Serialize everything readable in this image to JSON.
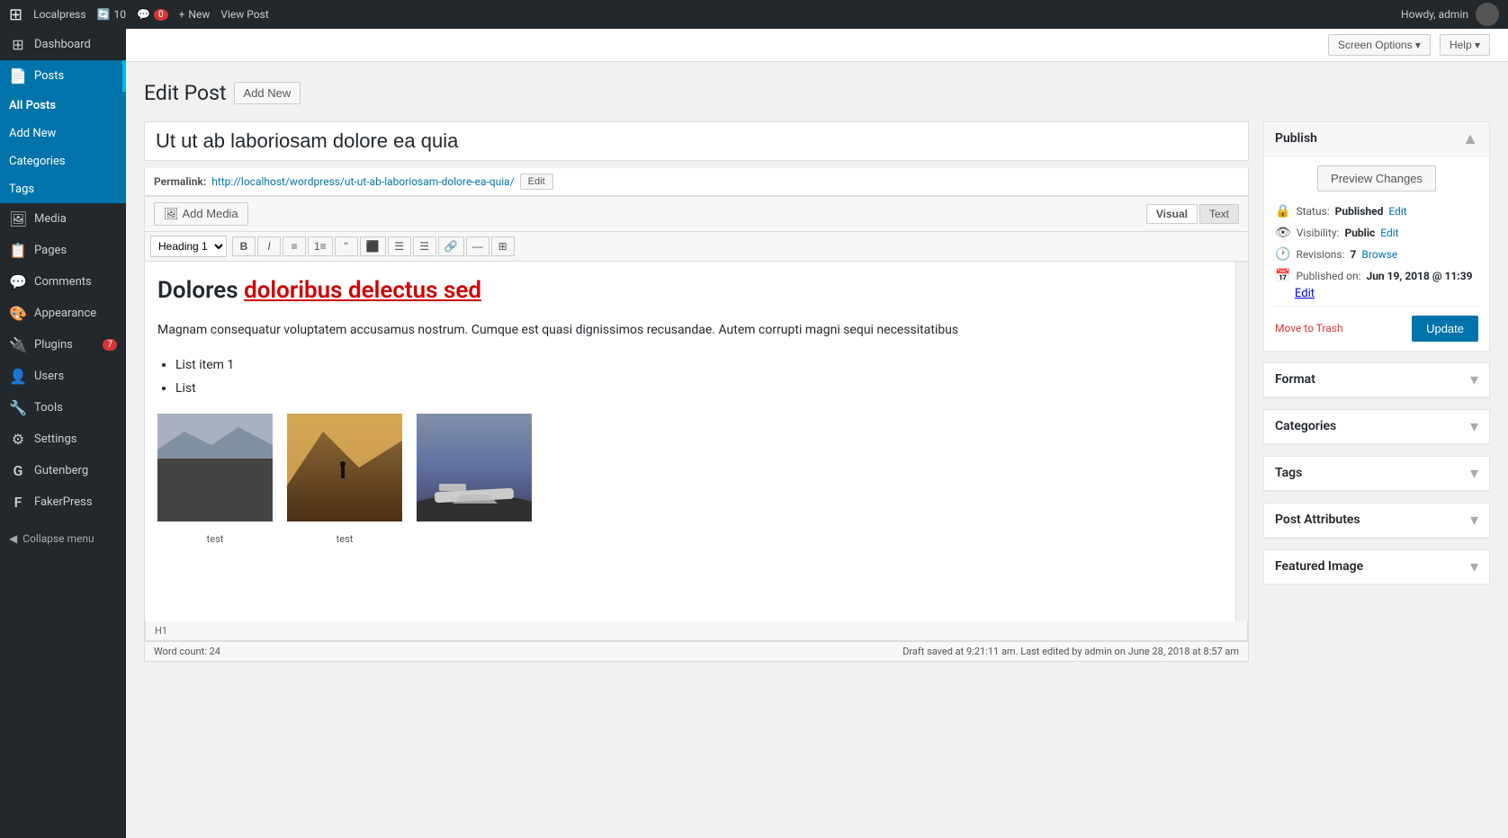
{
  "adminbar": {
    "site_name": "Localpress",
    "updates_count": "10",
    "comments_count": "0",
    "new_label": "New",
    "view_post_label": "View Post",
    "howdy": "Howdy, admin"
  },
  "screen_options": {
    "label": "Screen Options",
    "help_label": "Help"
  },
  "page": {
    "title": "Edit Post",
    "add_new_label": "Add New"
  },
  "post": {
    "title": "Ut ut ab laboriosam dolore ea quia",
    "permalink_label": "Permalink:",
    "permalink_url": "http://localhost/wordpress/ut-ut-ab-laboriosam-dolore-ea-quia/",
    "edit_label": "Edit",
    "add_media_label": "Add Media",
    "visual_tab": "Visual",
    "text_tab": "Text",
    "heading_option": "Heading 1",
    "editor_content_heading": "Dolores doloribus delectus sed",
    "editor_body": "Magnam consequatur voluptatem accusamus nostrum. Cumque est quasi dignissimos recusandae. Autem corrupti magni sequi necessitatibus",
    "list_item_1": "List item 1",
    "list_item_2": "List",
    "img_caption_1": "test",
    "img_caption_2": "test",
    "status_h1": "H1",
    "word_count_label": "Word count:",
    "word_count": "24",
    "draft_saved": "Draft saved at 9:21:11 am. Last edited by admin on June 28, 2018 at 8:57 am"
  },
  "sidebar": {
    "items": [
      {
        "label": "Dashboard",
        "icon": "⊞"
      },
      {
        "label": "Posts",
        "icon": "📄",
        "active": true
      },
      {
        "label": "Media",
        "icon": "🖼"
      },
      {
        "label": "Pages",
        "icon": "📋"
      },
      {
        "label": "Comments",
        "icon": "💬"
      },
      {
        "label": "Appearance",
        "icon": "🎨"
      },
      {
        "label": "Plugins",
        "icon": "🔌",
        "badge": "7"
      },
      {
        "label": "Users",
        "icon": "👤"
      },
      {
        "label": "Tools",
        "icon": "🔧"
      },
      {
        "label": "Settings",
        "icon": "⚙"
      },
      {
        "label": "Gutenberg",
        "icon": "G"
      },
      {
        "label": "FakerPress",
        "icon": "F"
      }
    ],
    "submenu": {
      "posts": [
        {
          "label": "All Posts",
          "active": true
        },
        {
          "label": "Add New"
        },
        {
          "label": "Categories"
        },
        {
          "label": "Tags"
        }
      ]
    },
    "collapse_label": "Collapse menu"
  },
  "publish_box": {
    "title": "Publish",
    "preview_changes_label": "Preview Changes",
    "status_label": "Status:",
    "status_value": "Published",
    "status_edit": "Edit",
    "visibility_label": "Visibility:",
    "visibility_value": "Public",
    "visibility_edit": "Edit",
    "revisions_label": "Revisions:",
    "revisions_count": "7",
    "revisions_browse": "Browse",
    "published_label": "Published on:",
    "published_value": "Jun 19, 2018 @ 11:39",
    "published_edit": "Edit",
    "move_to_trash": "Move to Trash",
    "update_label": "Update"
  },
  "format_box": {
    "title": "Format"
  },
  "categories_box": {
    "title": "Categories"
  },
  "tags_box": {
    "title": "Tags"
  },
  "post_attributes_box": {
    "title": "Post Attributes"
  },
  "featured_image_box": {
    "title": "Featured Image"
  }
}
